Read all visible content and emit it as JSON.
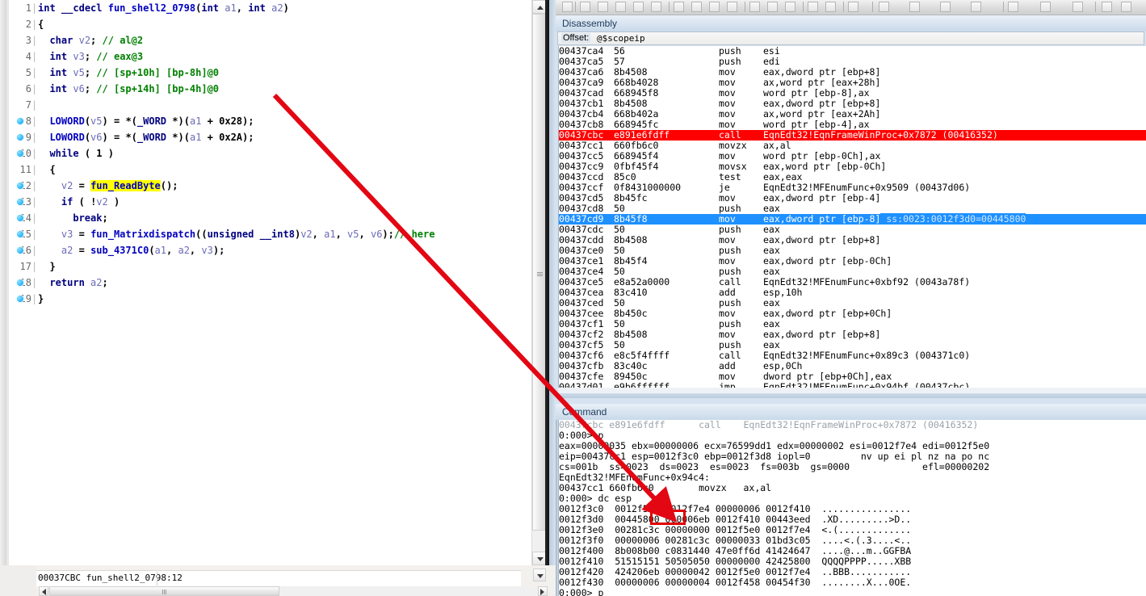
{
  "decompiler": {
    "status_address": "00037CBC",
    "status_function": "fun_shell2_0798:12",
    "lines": [
      {
        "n": "1",
        "bp": false,
        "code": "int __cdecl fun_shell2_0798(int a1, int a2)"
      },
      {
        "n": "2",
        "bp": false,
        "code": "{"
      },
      {
        "n": "3",
        "bp": false,
        "code": "  char v2; // al@2"
      },
      {
        "n": "4",
        "bp": false,
        "code": "  int v3; // eax@3"
      },
      {
        "n": "5",
        "bp": false,
        "code": "  int v5; // [sp+10h] [bp-8h]@0"
      },
      {
        "n": "6",
        "bp": false,
        "code": "  int v6; // [sp+14h] [bp-4h]@0"
      },
      {
        "n": "7",
        "bp": false,
        "code": ""
      },
      {
        "n": "8",
        "bp": true,
        "code": "  LOWORD(v5) = *(_WORD *)(a1 + 0x28);"
      },
      {
        "n": "9",
        "bp": true,
        "code": "  LOWORD(v6) = *(_WORD *)(a1 + 0x2A);"
      },
      {
        "n": "10",
        "bp": true,
        "code": "  while ( 1 )"
      },
      {
        "n": "11",
        "bp": false,
        "code": "  {"
      },
      {
        "n": "12",
        "bp": true,
        "code": "    v2 = fun_ReadByte();"
      },
      {
        "n": "13",
        "bp": true,
        "code": "    if ( !v2 )"
      },
      {
        "n": "14",
        "bp": true,
        "code": "      break;"
      },
      {
        "n": "15",
        "bp": true,
        "code": "    v3 = fun_Matrixdispatch((unsigned __int8)v2, a1, v5, v6);// here"
      },
      {
        "n": "16",
        "bp": true,
        "code": "    a2 = sub_4371C0(a1, a2, v3);"
      },
      {
        "n": "17",
        "bp": false,
        "code": "  }"
      },
      {
        "n": "18",
        "bp": true,
        "code": "  return a2;"
      },
      {
        "n": "19",
        "bp": true,
        "code": "}"
      }
    ],
    "highlight_token": "fun_ReadByte",
    "comment_token": "// here"
  },
  "disassembly": {
    "title": "Disassembly",
    "offset_label": "Offset:",
    "offset_value": "@$scopeip",
    "rows": [
      {
        "addr": "00437ca4",
        "bytes": "56",
        "mn": "push",
        "op": "esi",
        "hl": ""
      },
      {
        "addr": "00437ca5",
        "bytes": "57",
        "mn": "push",
        "op": "edi",
        "hl": ""
      },
      {
        "addr": "00437ca6",
        "bytes": "8b4508",
        "mn": "mov",
        "op": "eax,dword ptr [ebp+8]",
        "hl": ""
      },
      {
        "addr": "00437ca9",
        "bytes": "668b4028",
        "mn": "mov",
        "op": "ax,word ptr [eax+28h]",
        "hl": ""
      },
      {
        "addr": "00437cad",
        "bytes": "668945f8",
        "mn": "mov",
        "op": "word ptr [ebp-8],ax",
        "hl": ""
      },
      {
        "addr": "00437cb1",
        "bytes": "8b4508",
        "mn": "mov",
        "op": "eax,dword ptr [ebp+8]",
        "hl": ""
      },
      {
        "addr": "00437cb4",
        "bytes": "668b402a",
        "mn": "mov",
        "op": "ax,word ptr [eax+2Ah]",
        "hl": ""
      },
      {
        "addr": "00437cb8",
        "bytes": "668945fc",
        "mn": "mov",
        "op": "word ptr [ebp-4],ax",
        "hl": ""
      },
      {
        "addr": "00437cbc",
        "bytes": "e891e6fdff",
        "mn": "call",
        "op": "EqnEdt32!EqnFrameWinProc+0x7872 (00416352)",
        "hl": "red"
      },
      {
        "addr": "00437cc1",
        "bytes": "660fb6c0",
        "mn": "movzx",
        "op": "ax,al",
        "hl": ""
      },
      {
        "addr": "00437cc5",
        "bytes": "668945f4",
        "mn": "mov",
        "op": "word ptr [ebp-0Ch],ax",
        "hl": ""
      },
      {
        "addr": "00437cc9",
        "bytes": "0fbf45f4",
        "mn": "movsx",
        "op": "eax,word ptr [ebp-0Ch]",
        "hl": ""
      },
      {
        "addr": "00437ccd",
        "bytes": "85c0",
        "mn": "test",
        "op": "eax,eax",
        "hl": ""
      },
      {
        "addr": "00437ccf",
        "bytes": "0f8431000000",
        "mn": "je",
        "op": "EqnEdt32!MFEnumFunc+0x9509 (00437d06)",
        "hl": ""
      },
      {
        "addr": "00437cd5",
        "bytes": "8b45fc",
        "mn": "mov",
        "op": "eax,dword ptr [ebp-4]",
        "hl": ""
      },
      {
        "addr": "00437cd8",
        "bytes": "50",
        "mn": "push",
        "op": "eax",
        "hl": ""
      },
      {
        "addr": "00437cd9",
        "bytes": "8b45f8",
        "mn": "mov",
        "op": "eax,dword ptr [ebp-8]",
        "hl": "blue",
        "extra": "ss:0023:0012f3d0=00445800"
      },
      {
        "addr": "00437cdc",
        "bytes": "50",
        "mn": "push",
        "op": "eax",
        "hl": ""
      },
      {
        "addr": "00437cdd",
        "bytes": "8b4508",
        "mn": "mov",
        "op": "eax,dword ptr [ebp+8]",
        "hl": ""
      },
      {
        "addr": "00437ce0",
        "bytes": "50",
        "mn": "push",
        "op": "eax",
        "hl": ""
      },
      {
        "addr": "00437ce1",
        "bytes": "8b45f4",
        "mn": "mov",
        "op": "eax,dword ptr [ebp-0Ch]",
        "hl": ""
      },
      {
        "addr": "00437ce4",
        "bytes": "50",
        "mn": "push",
        "op": "eax",
        "hl": ""
      },
      {
        "addr": "00437ce5",
        "bytes": "e8a52a0000",
        "mn": "call",
        "op": "EqnEdt32!MFEnumFunc+0xbf92 (0043a78f)",
        "hl": ""
      },
      {
        "addr": "00437cea",
        "bytes": "83c410",
        "mn": "add",
        "op": "esp,10h",
        "hl": ""
      },
      {
        "addr": "00437ced",
        "bytes": "50",
        "mn": "push",
        "op": "eax",
        "hl": ""
      },
      {
        "addr": "00437cee",
        "bytes": "8b450c",
        "mn": "mov",
        "op": "eax,dword ptr [ebp+0Ch]",
        "hl": ""
      },
      {
        "addr": "00437cf1",
        "bytes": "50",
        "mn": "push",
        "op": "eax",
        "hl": ""
      },
      {
        "addr": "00437cf2",
        "bytes": "8b4508",
        "mn": "mov",
        "op": "eax,dword ptr [ebp+8]",
        "hl": ""
      },
      {
        "addr": "00437cf5",
        "bytes": "50",
        "mn": "push",
        "op": "eax",
        "hl": ""
      },
      {
        "addr": "00437cf6",
        "bytes": "e8c5f4ffff",
        "mn": "call",
        "op": "EqnEdt32!MFEnumFunc+0x89c3 (004371c0)",
        "hl": ""
      },
      {
        "addr": "00437cfb",
        "bytes": "83c40c",
        "mn": "add",
        "op": "esp,0Ch",
        "hl": ""
      },
      {
        "addr": "00437cfe",
        "bytes": "89450c",
        "mn": "mov",
        "op": "dword ptr [ebp+0Ch],eax",
        "hl": ""
      },
      {
        "addr": "00437d01",
        "bytes": "e9b6ffffff",
        "mn": "jmp",
        "op": "EqnEdt32!MFEnumFunc+0x94bf (00437cbc)",
        "hl": ""
      }
    ]
  },
  "command": {
    "title": "Command",
    "lines": [
      {
        "text": "00437cbc e891e6fdff      call    EqnEdt32!EqnFrameWinProc+0x7872 (00416352)",
        "faded": true
      },
      {
        "text": "0:000> p",
        "faded": false
      },
      {
        "text": "eax=00000035 ebx=00000006 ecx=76599dd1 edx=00000002 esi=0012f7e4 edi=0012f5e0",
        "faded": false
      },
      {
        "text": "eip=00437cc1 esp=0012f3c0 ebp=0012f3d8 iopl=0         nv up ei pl nz na po nc",
        "faded": false
      },
      {
        "text": "cs=001b  ss=0023  ds=0023  es=0023  fs=003b  gs=0000             efl=00000202",
        "faded": false
      },
      {
        "text": "EqnEdt32!MFEnumFunc+0x94c4:",
        "faded": false
      },
      {
        "text": "00437cc1 660fb6c0        movzx   ax,al",
        "faded": false
      },
      {
        "text": "0:000> dc esp",
        "faded": false
      },
      {
        "text": "0012f3c0  0012f5e0 0012f7e4 00000006 0012f410  ................",
        "faded": false
      },
      {
        "text": "0012f3d0  00445800 000006eb 0012f410 00443eed  .XD.........>D..",
        "faded": false
      },
      {
        "text": "0012f3e0  00281c3c 00000000 0012f5e0 0012f7e4  <.(.............",
        "faded": false
      },
      {
        "text": "0012f3f0  00000006 00281c3c 00000033 01bd3c05  ....<.(.3....<..",
        "faded": false
      },
      {
        "text": "0012f400  8b008b00 c0831440 47e0ff6d 41424647  ....@...m..GGFBA",
        "faded": false
      },
      {
        "text": "0012f410  51515151 50505050 00000000 42425800  QQQQPPPP.....XBB",
        "faded": false
      },
      {
        "text": "0012f420  424206eb 00000042 0012f5e0 0012f7e4  ..BBB...........",
        "faded": false
      },
      {
        "text": "0012f430  00000006 00000004 0012f458 00454f30  ........X...0OE.",
        "faded": false
      },
      {
        "text": "0:000> p",
        "faded": false
      }
    ]
  },
  "annotation": {
    "arrow_color": "#e30613",
    "box_color": "#e00000",
    "box_target": "5800"
  }
}
